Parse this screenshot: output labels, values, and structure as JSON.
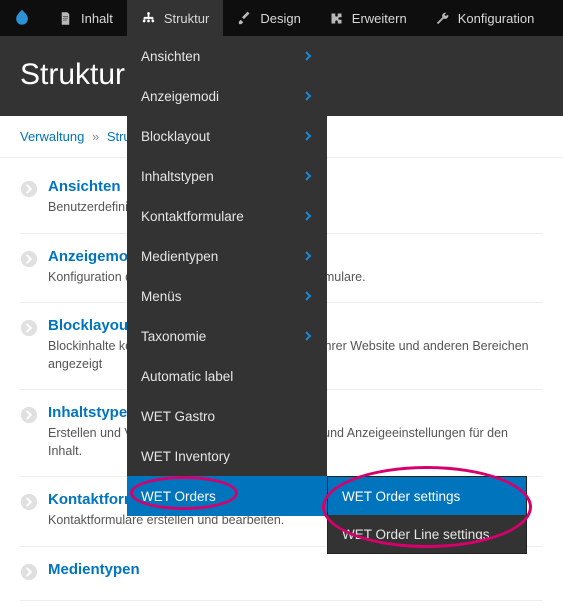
{
  "toolbar": {
    "items": [
      {
        "label": "Inhalt"
      },
      {
        "label": "Struktur"
      },
      {
        "label": "Design"
      },
      {
        "label": "Erweitern"
      },
      {
        "label": "Konfiguration"
      }
    ]
  },
  "page_title": "Struktur",
  "breadcrumb": {
    "root": "Verwaltung",
    "current": "Struktur"
  },
  "sections": [
    {
      "title": "Ansichten",
      "desc": "Benutzerdefinierte"
    },
    {
      "title": "Anzeigemodi",
      "desc": "Konfiguration der Anzeigemodi für Inhalte und Formulare."
    },
    {
      "title": "Blocklayout",
      "desc": "Blockinhalte konfigurieren, die in der Seitenleiste Ihrer Website und anderen Bereichen angezeigt"
    },
    {
      "title": "Inhaltstypen",
      "desc": "Erstellen und Verwalten von Feldern, Formularen und Anzeigeeinstellungen für den Inhalt."
    },
    {
      "title": "Kontaktformulare",
      "desc": "Kontaktformulare erstellen und bearbeiten."
    },
    {
      "title": "Medientypen",
      "desc": ""
    }
  ],
  "dropdown": {
    "items": [
      {
        "label": "Ansichten",
        "has_children": true
      },
      {
        "label": "Anzeigemodi",
        "has_children": true
      },
      {
        "label": "Blocklayout",
        "has_children": true
      },
      {
        "label": "Inhaltstypen",
        "has_children": true
      },
      {
        "label": "Kontaktformulare",
        "has_children": true
      },
      {
        "label": "Medientypen",
        "has_children": true
      },
      {
        "label": "Menüs",
        "has_children": true
      },
      {
        "label": "Taxonomie",
        "has_children": true
      },
      {
        "label": "Automatic label",
        "has_children": false
      },
      {
        "label": "WET Gastro",
        "has_children": false
      },
      {
        "label": "WET Inventory",
        "has_children": false
      },
      {
        "label": "WET Orders",
        "has_children": false,
        "selected": true
      }
    ]
  },
  "submenu": {
    "items": [
      {
        "label": "WET Order settings",
        "selected": true
      },
      {
        "label": "WET Order Line settings",
        "selected": false
      }
    ]
  }
}
